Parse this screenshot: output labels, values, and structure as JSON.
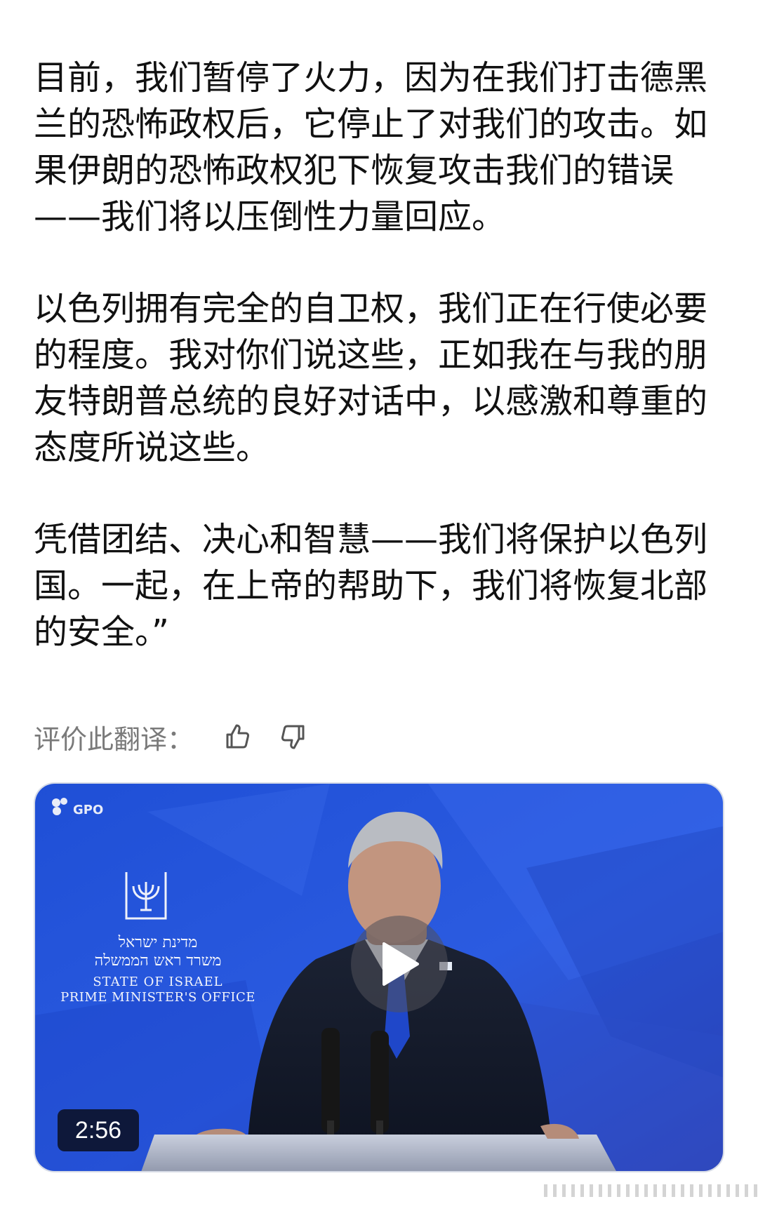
{
  "article": {
    "paragraphs": [
      "目前，我们暂停了火力，因为在我们打击德黑\n兰的恐怖政权后，它停止了对我们的攻击。如\n果伊朗的恐怖政权犯下恢复攻击我们的错误\n——我们将以压倒性力量回应。",
      "以色列拥有完全的自卫权，我们正在行使必要\n的程度。我对你们说这些，正如我在与我的朋\n友特朗普总统的良好对话中，以感激和尊重的\n态度所说这些。",
      "凭借团结、决心和智慧——我们将保护以色列\n国。一起，在上帝的帮助下，我们将恢复北部\n的安全。”"
    ]
  },
  "translation_rating": {
    "label": "评价此翻译：",
    "icons": [
      "thumbs-up-icon",
      "thumbs-down-icon"
    ]
  },
  "video": {
    "duration": "2:56",
    "logo_text": "GPO",
    "backdrop_hebrew_1": "מדינת ישראל",
    "backdrop_hebrew_2": "משרד ראש הממשלה",
    "backdrop_english_1": "STATE OF ISRAEL",
    "backdrop_english_2": "PRIME MINISTER'S OFFICE",
    "play_icon": "play-icon",
    "colors": {
      "background": "#2b56d8",
      "overlay": "#0a0e1e"
    }
  }
}
